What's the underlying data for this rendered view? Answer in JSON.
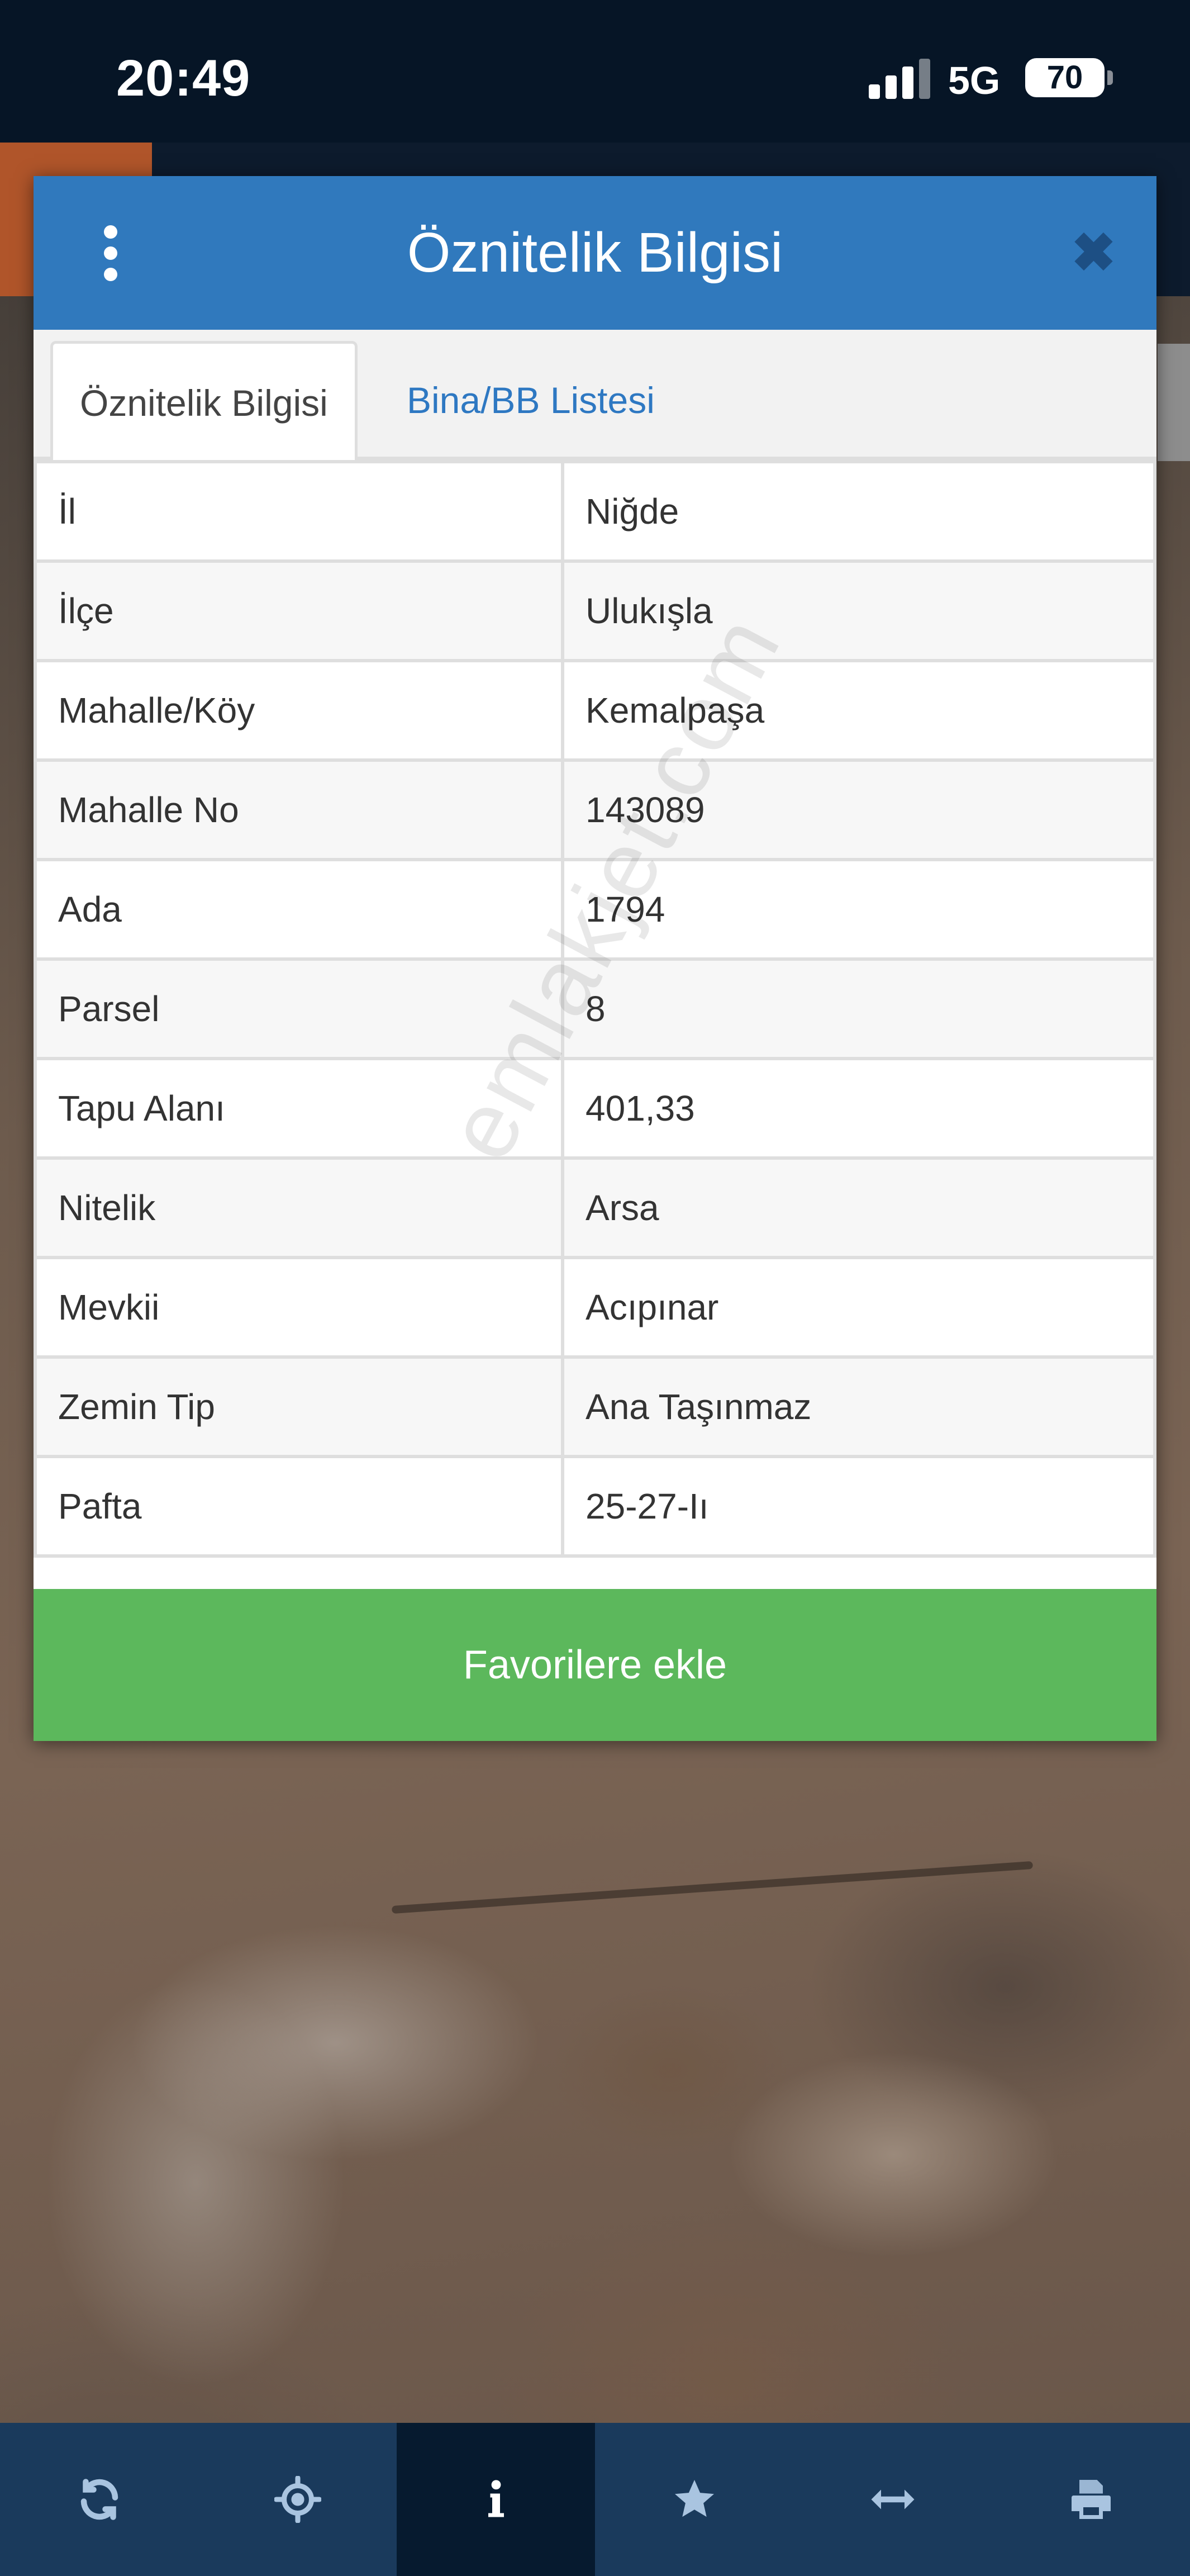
{
  "status_bar": {
    "time": "20:49",
    "network": "5G",
    "battery": "70"
  },
  "dialog": {
    "title": "Öznitelik Bilgisi",
    "close_symbol": "✖",
    "menu_icon": "kebab-menu-icon",
    "tabs": [
      {
        "label": "Öznitelik Bilgisi",
        "active": true
      },
      {
        "label": "Bina/BB Listesi",
        "active": false
      }
    ],
    "rows": [
      {
        "key": "İl",
        "value": "Niğde"
      },
      {
        "key": "İlçe",
        "value": "Ulukışla"
      },
      {
        "key": "Mahalle/Köy",
        "value": "Kemalpaşa"
      },
      {
        "key": "Mahalle No",
        "value": "143089"
      },
      {
        "key": "Ada",
        "value": "1794"
      },
      {
        "key": "Parsel",
        "value": "8"
      },
      {
        "key": "Tapu Alanı",
        "value": "401,33"
      },
      {
        "key": "Nitelik",
        "value": "Arsa"
      },
      {
        "key": "Mevkii",
        "value": "Acıpınar"
      },
      {
        "key": "Zemin Tip",
        "value": "Ana Taşınmaz"
      },
      {
        "key": "Pafta",
        "value": "25-27-Iı"
      }
    ],
    "favorite_button": "Favorilere ekle"
  },
  "watermark": "emlakjet.com",
  "toolbar": {
    "items": [
      {
        "icon": "refresh-icon",
        "active": false
      },
      {
        "icon": "crosshair-icon",
        "active": false
      },
      {
        "icon": "info-icon",
        "active": true
      },
      {
        "icon": "star-icon",
        "active": false
      },
      {
        "icon": "measure-arrows-icon",
        "active": false
      },
      {
        "icon": "print-icon",
        "active": false
      }
    ]
  },
  "colors": {
    "header_blue": "#3079bd",
    "favorite_green": "#5cb85c",
    "tab_link_blue": "#2e78c2",
    "toolbar_navy": "#1a3a5c",
    "status_bar": "#061526"
  }
}
